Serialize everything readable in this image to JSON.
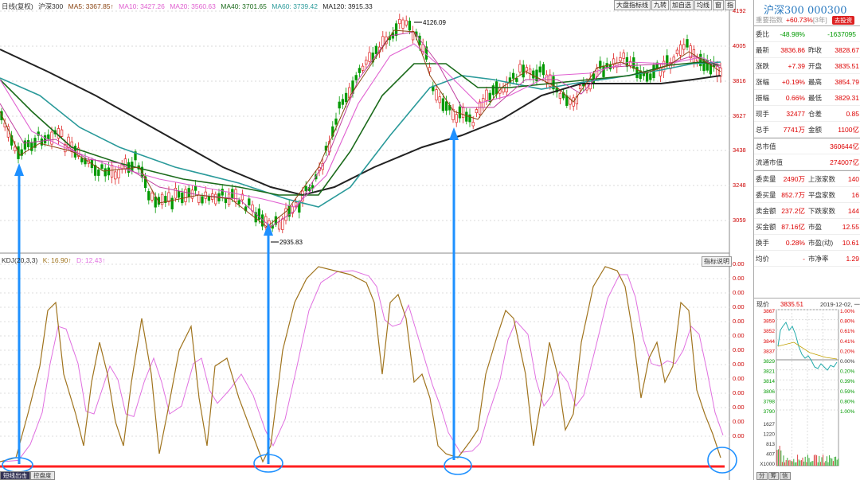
{
  "legend": {
    "period": "日线(复权)",
    "name": "沪深300",
    "ma5": "MA5: 3367.85↑",
    "ma10": "MA10: 3427.26",
    "ma20": "MA20: 3560.63",
    "ma40": "MA40: 3701.65",
    "ma60": "MA60: 3739.42",
    "ma120": "MA120: 3915.33"
  },
  "toolbar": [
    "大盘指标线",
    "九转",
    "加自选",
    "均线",
    "窗",
    "指"
  ],
  "kdj_legend": {
    "name": "KDJ(20,3,3)",
    "k": "K: 16.90↑",
    "d": "D: 12.43↑"
  },
  "zhibiao_label": "指标说明",
  "bottom_tabs": [
    "短线出击",
    "控盘度"
  ],
  "price_axis": [
    "4192",
    "4005",
    "3816",
    "3627",
    "3438",
    "3248",
    "3059"
  ],
  "kdj_axis": [
    "0.00",
    "0.00",
    "0.00",
    "0.00",
    "0.00",
    "0.00",
    "0.00",
    "0.00",
    "0.00",
    "0.00",
    "0.00",
    "0.00",
    "0.00"
  ],
  "annotations": {
    "high": "4126.09",
    "low": "2935.83"
  },
  "colors": {
    "ma5": "#8b4513",
    "ma10": "#e060d0",
    "ma20": "#1a6a1a",
    "ma40": "#2a9a9a",
    "ma60": "#222222",
    "up": "#d22",
    "down": "#090",
    "arrow": "#1e90ff",
    "k": "#a0741e",
    "d": "#e070e0",
    "baseline": "#ff2020"
  },
  "panel": {
    "title": "沪深300 000300",
    "sub_label": "重要指数",
    "sub_change": "+60.73%",
    "sub_years": "[3年]",
    "badge": "去投资",
    "weibi_label": "委比",
    "weibi_val": "-48.98%",
    "weibi_diff": "-1637095",
    "rows": [
      {
        "l": "最新",
        "v1": "3836.86",
        "l2": "昨收",
        "v2": "3828.67"
      },
      {
        "l": "涨跌",
        "v1": "+7.39",
        "l2": "开盘",
        "v2": "3835.51"
      },
      {
        "l": "涨幅",
        "v1": "+0.19%",
        "l2": "最高",
        "v2": "3854.79"
      },
      {
        "l": "振幅",
        "v1": "0.66%",
        "l2": "最低",
        "v2": "3829.31"
      },
      {
        "l": "现手",
        "v1": "32477",
        "l2": "仓差",
        "v2": "0.85"
      },
      {
        "l": "总手",
        "v1": "7741万",
        "l2": "金额",
        "v2": "1100亿"
      }
    ],
    "mktcap": [
      {
        "l": "总市值",
        "v": "360644亿"
      },
      {
        "l": "流通市值",
        "v": "274007亿"
      }
    ],
    "rows2": [
      {
        "l": "委卖量",
        "v1": "2490万",
        "l2": "上涨家数",
        "v2": "140"
      },
      {
        "l": "委买量",
        "v1": "852.7万",
        "l2": "平盘家数",
        "v2": "16"
      },
      {
        "l": "卖金额",
        "v1": "237.2亿",
        "l2": "下跌家数",
        "v2": "144"
      },
      {
        "l": "买金额",
        "v1": "87.16亿",
        "l2": "市盈",
        "v2": "12.55"
      },
      {
        "l": "换手",
        "v1": "0.28%",
        "l2": "市盈(动)",
        "v2": "10.61"
      },
      {
        "l": "均价",
        "v1": "-",
        "l2": "市净率",
        "v2": "1.29"
      }
    ],
    "now_label": "现价",
    "now_price": "3835.51",
    "now_date": "2019-12-02, 一",
    "mini_left": [
      "3867",
      "3859",
      "3852",
      "3844",
      "3837",
      "3829",
      "3821",
      "3814",
      "3806",
      "3798",
      "3790",
      "1627",
      "1220",
      "813",
      "407",
      "X1000"
    ],
    "mini_right": [
      "1.00%",
      "0.80%",
      "0.61%",
      "0.41%",
      "0.20%",
      "0.00%",
      "0.20%",
      "0.39%",
      "0.59%",
      "0.80%",
      "1.00%"
    ],
    "mini_tabs": [
      "分",
      "筹",
      "信"
    ]
  }
}
